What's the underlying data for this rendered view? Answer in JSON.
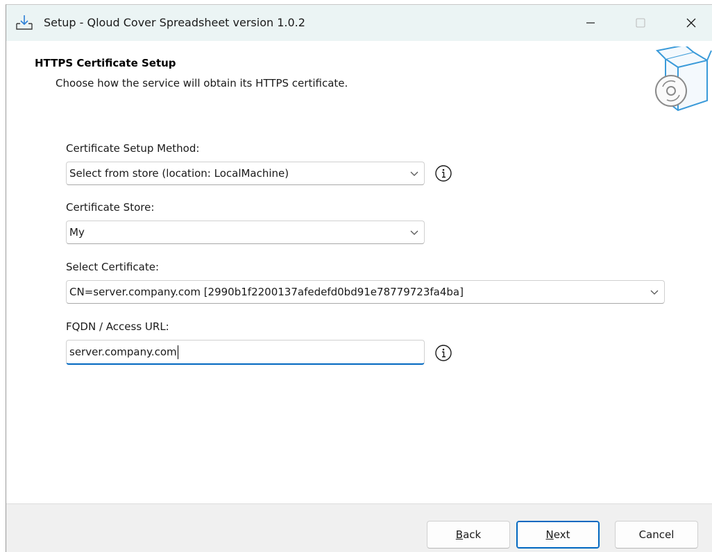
{
  "window": {
    "title": "Setup - Qloud Cover Spreadsheet version 1.0.2"
  },
  "header": {
    "title": "HTTPS Certificate Setup",
    "subtitle": "Choose how the service will obtain its HTTPS certificate."
  },
  "form": {
    "method_label": "Certificate Setup Method:",
    "method_value": "Select from store (location: LocalMachine)",
    "store_label": "Certificate Store:",
    "store_value": "My",
    "certificate_label": "Select Certificate:",
    "certificate_value": "CN=server.company.com [2990b1f2200137afedefd0bd91e78779723fa4ba]",
    "fqdn_label": "FQDN / Access URL:",
    "fqdn_value": "server.company.com"
  },
  "buttons": {
    "back_hotkey": "B",
    "back_rest": "ack",
    "next_hotkey": "N",
    "next_rest": "ext",
    "cancel": "Cancel"
  },
  "icons": {
    "app": "download-tray-icon",
    "wizard": "software-box-disc-icon",
    "info": "info-icon",
    "dropdown": "chevron-down-icon"
  },
  "colors": {
    "titlebar": "#ebf4f4",
    "accent": "#0067c0",
    "footer": "#f0f0f0"
  }
}
